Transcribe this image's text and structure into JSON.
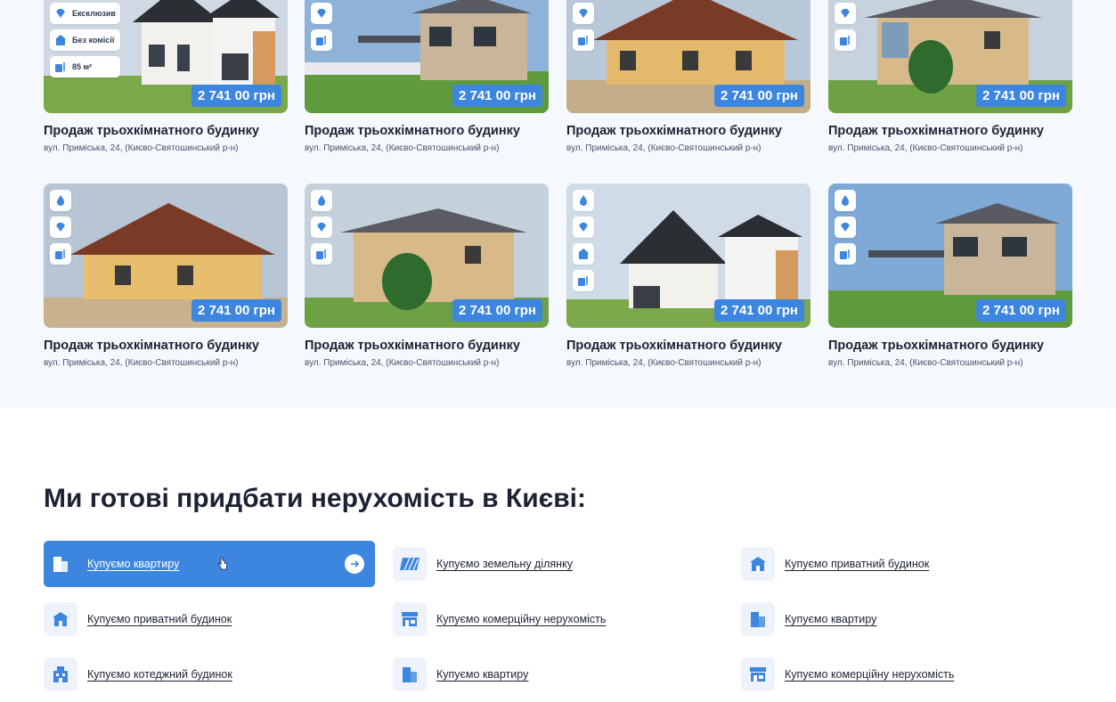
{
  "listings": [
    {
      "title": "Продаж трьохкімнатного будинку",
      "address": "вул. Приміська, 24, (Києво-Святошинський р-н)",
      "price": "2 741 00 грн",
      "badges": [
        "Ексклюзив",
        "Без комісії",
        "85 м²"
      ]
    },
    {
      "title": "Продаж трьохкімнатного будинку",
      "address": "вул. Приміська, 24, (Києво-Святошинський р-н)",
      "price": "2 741 00 грн"
    },
    {
      "title": "Продаж трьохкімнатного будинку",
      "address": "вул. Приміська, 24, (Києво-Святошинський р-н)",
      "price": "2 741 00 грн"
    },
    {
      "title": "Продаж трьохкімнатного будинку",
      "address": "вул. Приміська, 24, (Києво-Святошинський р-н)",
      "price": "2 741 00 грн"
    },
    {
      "title": "Продаж трьохкімнатного будинку",
      "address": "вул. Приміська, 24, (Києво-Святошинський р-н)",
      "price": "2 741 00 грн"
    },
    {
      "title": "Продаж трьохкімнатного будинку",
      "address": "вул. Приміська, 24, (Києво-Святошинський р-н)",
      "price": "2 741 00 грн"
    },
    {
      "title": "Продаж трьохкімнатного будинку",
      "address": "вул. Приміська, 24, (Києво-Святошинський р-н)",
      "price": "2 741 00 грн"
    },
    {
      "title": "Продаж трьохкімнатного будинку",
      "address": "вул. Приміська, 24, (Києво-Святошинський р-н)",
      "price": "2 741 00 грн"
    }
  ],
  "section_title": "Ми готові придбати нерухомість в Києві:",
  "buy_links": [
    {
      "label": "Купуємо квартиру",
      "icon": "apartment-icon",
      "active": true
    },
    {
      "label": "Купуємо земельну ділянку",
      "icon": "land-icon"
    },
    {
      "label": "Купуємо приватний будинок",
      "icon": "house-icon"
    },
    {
      "label": "Купуємо приватний будинок",
      "icon": "house-icon"
    },
    {
      "label": "Купуємо комерційну нерухомість",
      "icon": "store-icon"
    },
    {
      "label": "Купуємо квартиру",
      "icon": "apartment-icon"
    },
    {
      "label": "Купуємо котеджний будинок",
      "icon": "cottage-icon"
    },
    {
      "label": "Купуємо квартиру",
      "icon": "apartment-icon"
    },
    {
      "label": "Купуємо комерційну нерухомість",
      "icon": "store-icon"
    }
  ],
  "colors": {
    "accent": "#3d86e0",
    "page_bg": "#f5f8fd",
    "text": "#1c2233"
  }
}
